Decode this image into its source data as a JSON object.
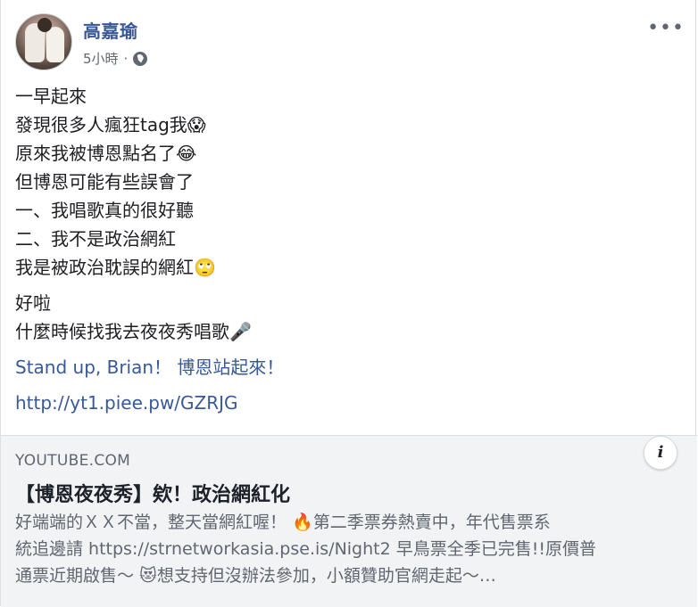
{
  "post": {
    "author": "高嘉瑜",
    "time": "5小時",
    "separator": "·",
    "more_label": "•••",
    "lines": [
      "一早起來",
      "發現很多人瘋狂tag我😱",
      "原來我被博恩點名了😂",
      "但博恩可能有些誤會了",
      "一、我唱歌真的很好聽",
      "二、我不是政治網紅",
      "我是被政治耽誤的網紅🙄"
    ],
    "lines2": [
      "好啦",
      "什麼時候找我去夜夜秀唱歌🎤"
    ],
    "tagline_link1": "Stand up, Brian！",
    "tagline_link2": "博恩站起來！",
    "url": "http://yt1.piee.pw/GZRJG"
  },
  "link_card": {
    "source": "YOUTUBE.COM",
    "title": "【博恩夜夜秀】欸！政治網紅化",
    "description_lines": [
      "好端端的ＸＸ不當，整天當網紅喔！ 🔥第二季票券熱賣中，年代售票系",
      "統追邊請 https://strnetworkasia.pse.is/Night2 早鳥票全季已完售!!原價普",
      "通票近期啟售～ 😻想支持但沒辦法參加，小額贊助官網走起～…"
    ],
    "info_icon": "i"
  },
  "colors": {
    "link": "#385898",
    "secondary": "#606770",
    "card_bg": "#f2f3f5"
  }
}
